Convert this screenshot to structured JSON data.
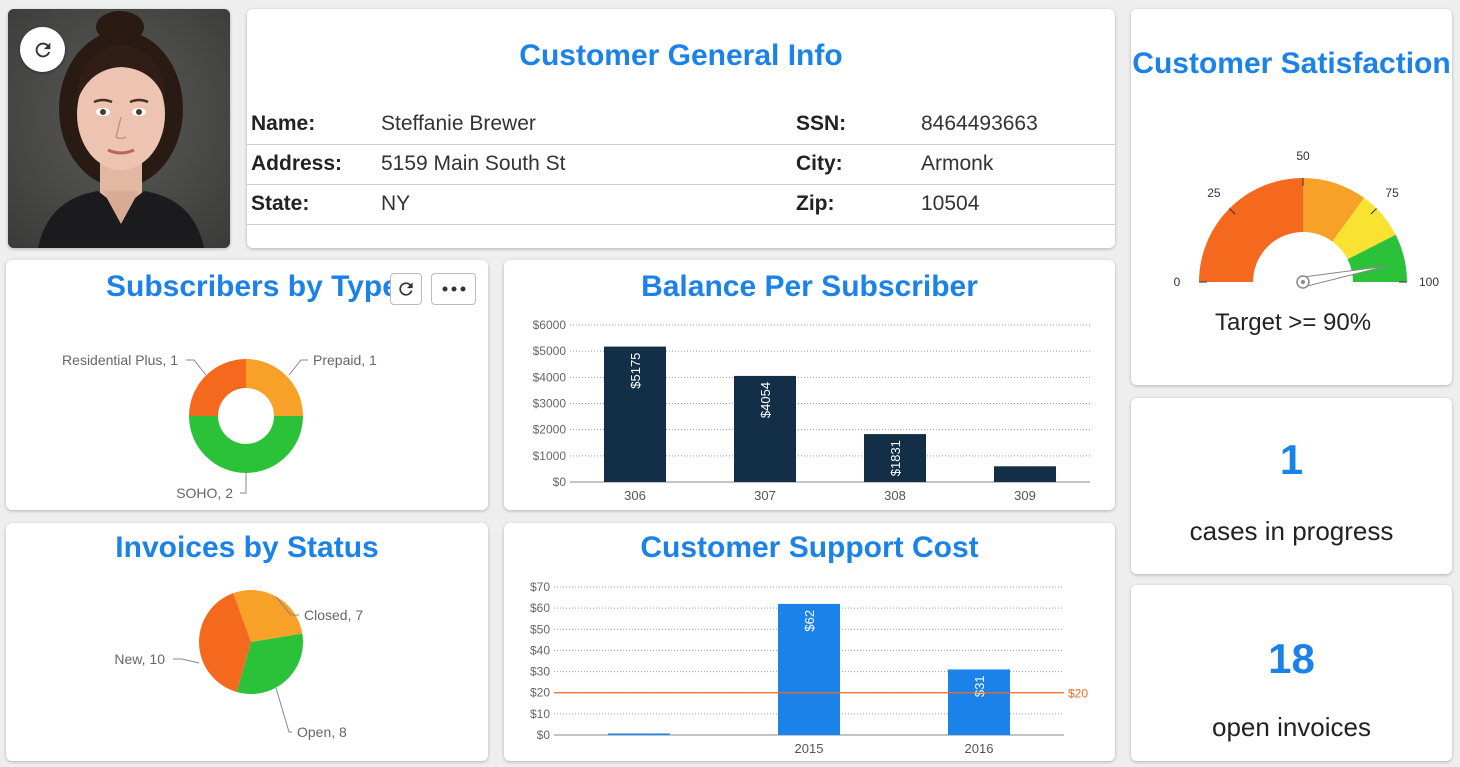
{
  "customer_info": {
    "title": "Customer General Info",
    "rows": [
      {
        "label1": "Name:",
        "value1": "Steffanie Brewer",
        "label2": "SSN:",
        "value2": "8464493663"
      },
      {
        "label1": "Address:",
        "value1": "5159 Main South St",
        "label2": "City:",
        "value2": "Armonk"
      },
      {
        "label1": "State:",
        "value1": "NY",
        "label2": "Zip:",
        "value2": "10504"
      }
    ]
  },
  "satisfaction": {
    "title": "Customer Satisfaction",
    "ticks": [
      "0",
      "25",
      "50",
      "75",
      "100"
    ],
    "target_label": "Target >= 90%",
    "bands": [
      {
        "from": 0,
        "to": 50,
        "color": "#f5691f"
      },
      {
        "from": 50,
        "to": 70,
        "color": "#f7a128"
      },
      {
        "from": 70,
        "to": 85,
        "color": "#f9e231"
      },
      {
        "from": 85,
        "to": 100,
        "color": "#2bc23a"
      }
    ],
    "needle_value": 94
  },
  "kpis": {
    "cases": {
      "value": "1",
      "label": "cases in progress"
    },
    "invoices": {
      "value": "18",
      "label": "open invoices"
    }
  },
  "icons": {
    "refresh": "refresh-icon",
    "more": "more-icon"
  },
  "chart_data": [
    {
      "id": "subscribers",
      "type": "pie",
      "title": "Subscribers by Type",
      "donut": true,
      "slices": [
        {
          "label": "Prepaid, 1",
          "value": 1,
          "color": "#f7a128"
        },
        {
          "label": "SOHO, 2",
          "value": 2,
          "color": "#2bc23a"
        },
        {
          "label": "Residential Plus, 1",
          "value": 1,
          "color": "#f5691f"
        }
      ]
    },
    {
      "id": "balance",
      "type": "bar",
      "title": "Balance Per Subscriber",
      "categories": [
        "306",
        "307",
        "308",
        "309"
      ],
      "values": [
        5175,
        4054,
        1831,
        600
      ],
      "value_labels": [
        "$5175",
        "$4054",
        "$1831",
        ""
      ],
      "yticks": [
        "$0",
        "$1000",
        "$2000",
        "$3000",
        "$4000",
        "$5000",
        "$6000"
      ],
      "ylim": [
        0,
        6000
      ],
      "color": "#132f48",
      "grid": true
    },
    {
      "id": "invoices",
      "type": "pie",
      "title": "Invoices by Status",
      "donut": false,
      "slices": [
        {
          "label": "Closed, 7",
          "value": 7,
          "color": "#f7a128"
        },
        {
          "label": "Open, 8",
          "value": 8,
          "color": "#2bc23a"
        },
        {
          "label": "New, 10",
          "value": 10,
          "color": "#f5691f"
        }
      ]
    },
    {
      "id": "support",
      "type": "bar",
      "title": "Customer Support Cost",
      "categories": [
        "",
        "2015",
        "2016"
      ],
      "values": [
        0,
        62,
        31
      ],
      "value_labels": [
        "",
        "$62",
        "$31"
      ],
      "yticks": [
        "$0",
        "$10",
        "$20",
        "$30",
        "$40",
        "$50",
        "$60",
        "$70"
      ],
      "ylim": [
        0,
        70
      ],
      "color": "#1a82e8",
      "grid": true,
      "reference_line": {
        "value": 20,
        "label": "$20",
        "color": "#f5691f"
      }
    }
  ]
}
